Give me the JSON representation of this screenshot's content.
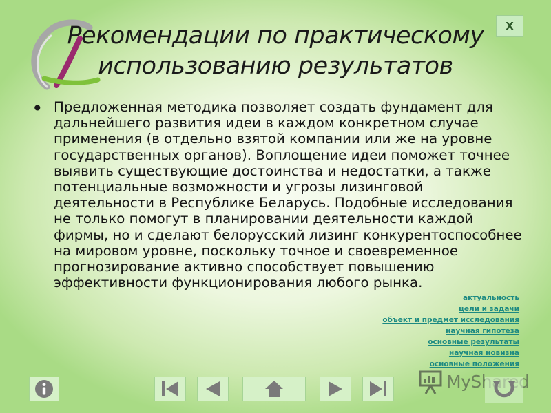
{
  "slide": {
    "title_line1": "Рекомендации по практическому",
    "title_line2": "использованию результатов",
    "close_label": "X",
    "body_text": "Предложенная методика позволяет создать фундамент для дальнейшего развития идеи в каждом конкретном случае применения (в отдельно взятой компании или же на уровне государственных органов). Воплощение идеи поможет точнее выявить существующие достоинства и недостатки, а также потенциальные возможности и угрозы лизинговой деятельности в Республике Беларусь. Подобные исследования не только помогут в планировании деятельности каждой фирмы, но и сделают белорусский лизинг конкурентоспособнее на мировом уровне, поскольку точное и своевременное прогнозирование активно способствует повышению эффективности функционирования любого рынка."
  },
  "links": [
    "актуальность",
    "цели и задачи",
    "объект и предмет исследования",
    "научная гипотеза",
    "основные результаты",
    "научная новизна",
    "основные положения"
  ],
  "nav": {
    "icons": [
      "info-icon",
      "first-slide-icon",
      "previous-slide-icon",
      "home-icon",
      "next-slide-icon",
      "last-slide-icon",
      "replay-icon"
    ]
  },
  "watermark": {
    "text": "MyShared"
  },
  "colors": {
    "link": "#1d8a82",
    "nav_button": "#d6f1c8",
    "nav_icon": "#7a7a7a",
    "background_edge": "#a9db85"
  }
}
